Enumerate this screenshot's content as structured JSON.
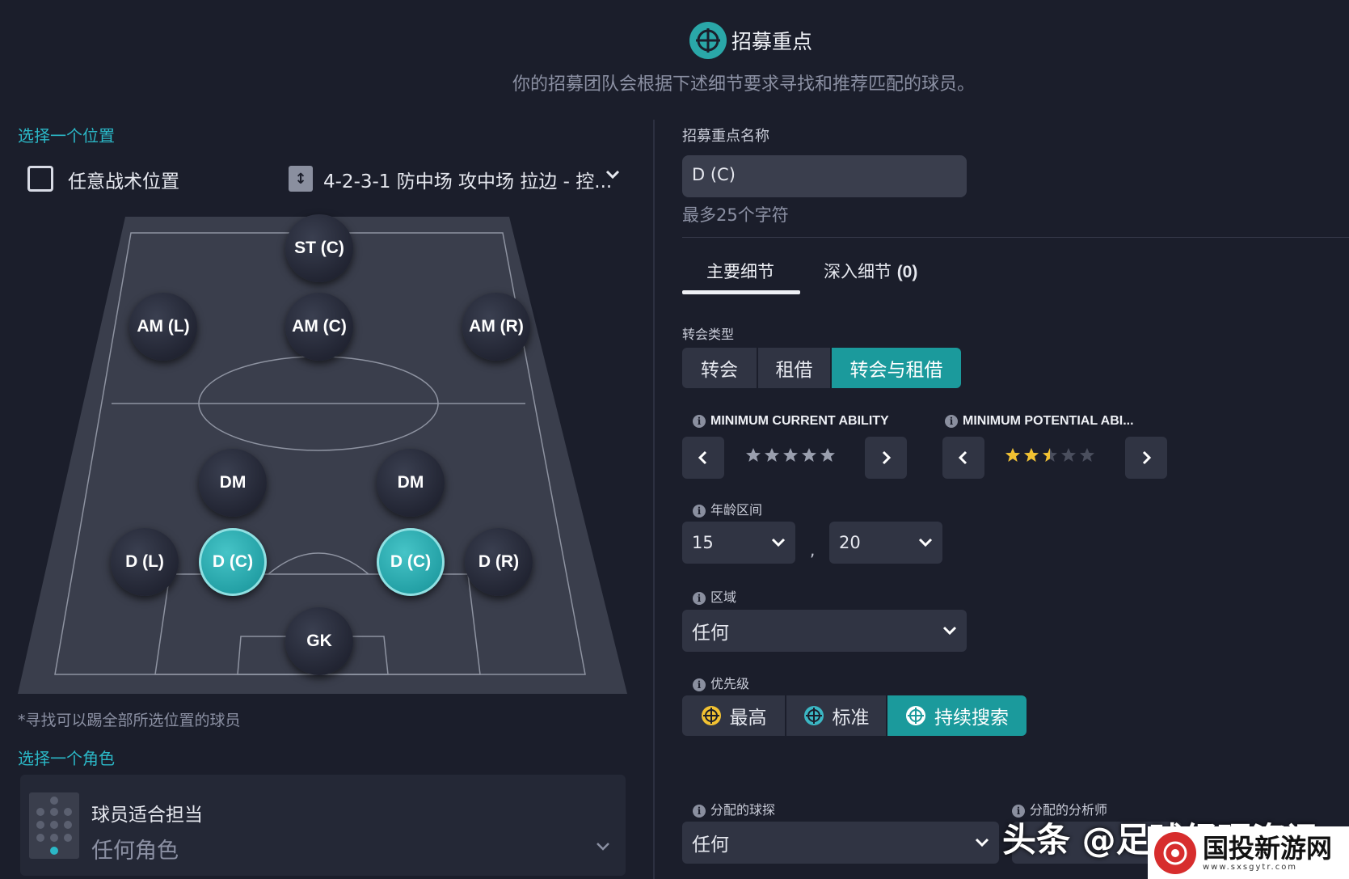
{
  "header": {
    "title": "招募重点",
    "subtitle": "你的招募团队会根据下述细节要求寻找和推荐匹配的球员。"
  },
  "left": {
    "select_position_label": "选择一个位置",
    "any_position_label": "任意战术位置",
    "tactic_label": "4-2-3-1 防中场 攻中场 拉边 - 控...",
    "positions": [
      {
        "label": "ST (C)",
        "selected": false
      },
      {
        "label": "AM (L)",
        "selected": false
      },
      {
        "label": "AM (C)",
        "selected": false
      },
      {
        "label": "AM (R)",
        "selected": false
      },
      {
        "label": "DM",
        "selected": false
      },
      {
        "label": "DM",
        "selected": false
      },
      {
        "label": "D (L)",
        "selected": false
      },
      {
        "label": "D (C)",
        "selected": true
      },
      {
        "label": "D (C)",
        "selected": true
      },
      {
        "label": "D (R)",
        "selected": false
      },
      {
        "label": "GK",
        "selected": false
      }
    ],
    "note": "*寻找可以踢全部所选位置的球员",
    "select_role_label": "选择一个角色",
    "role_title": "球员适合担当",
    "role_value": "任何角色"
  },
  "right": {
    "name_label": "招募重点名称",
    "name_value": "D (C)",
    "name_hint": "最多25个字符",
    "tabs": {
      "main": "主要细节",
      "deep": "深入细节",
      "deep_count": "(0)"
    },
    "transfer_type_label": "转会类型",
    "transfer_types": [
      {
        "label": "转会",
        "active": false
      },
      {
        "label": "租借",
        "active": false
      },
      {
        "label": "转会与租借",
        "active": true
      }
    ],
    "min_current_label": "MINIMUM CURRENT ABILITY",
    "min_current_stars": 0,
    "min_potential_label": "MINIMUM POTENTIAL ABI...",
    "min_potential_stars": 2.5,
    "age_label": "年龄区间",
    "age_min": "15",
    "age_sep": ",",
    "age_max": "20",
    "region_label": "区域",
    "region_value": "任何",
    "priority_label": "优先级",
    "priorities": [
      {
        "label": "最高",
        "active": false,
        "icon_color": "#f2c232"
      },
      {
        "label": "标准",
        "active": false,
        "icon_color": "#3bb7c4"
      },
      {
        "label": "持续搜索",
        "active": true,
        "icon_color": "#ffffff"
      }
    ],
    "scout_label": "分配的球探",
    "scout_value": "任何",
    "analyst_label": "分配的分析师"
  },
  "watermark": {
    "text1": "头条 @足球经理资讯",
    "text2": "国投新游网",
    "url": "www.sxsgytr.com"
  },
  "colors": {
    "accent": "#1b9a9c",
    "link": "#2bb7c6",
    "star": "#f2c232",
    "background": "#1b1e2b"
  }
}
